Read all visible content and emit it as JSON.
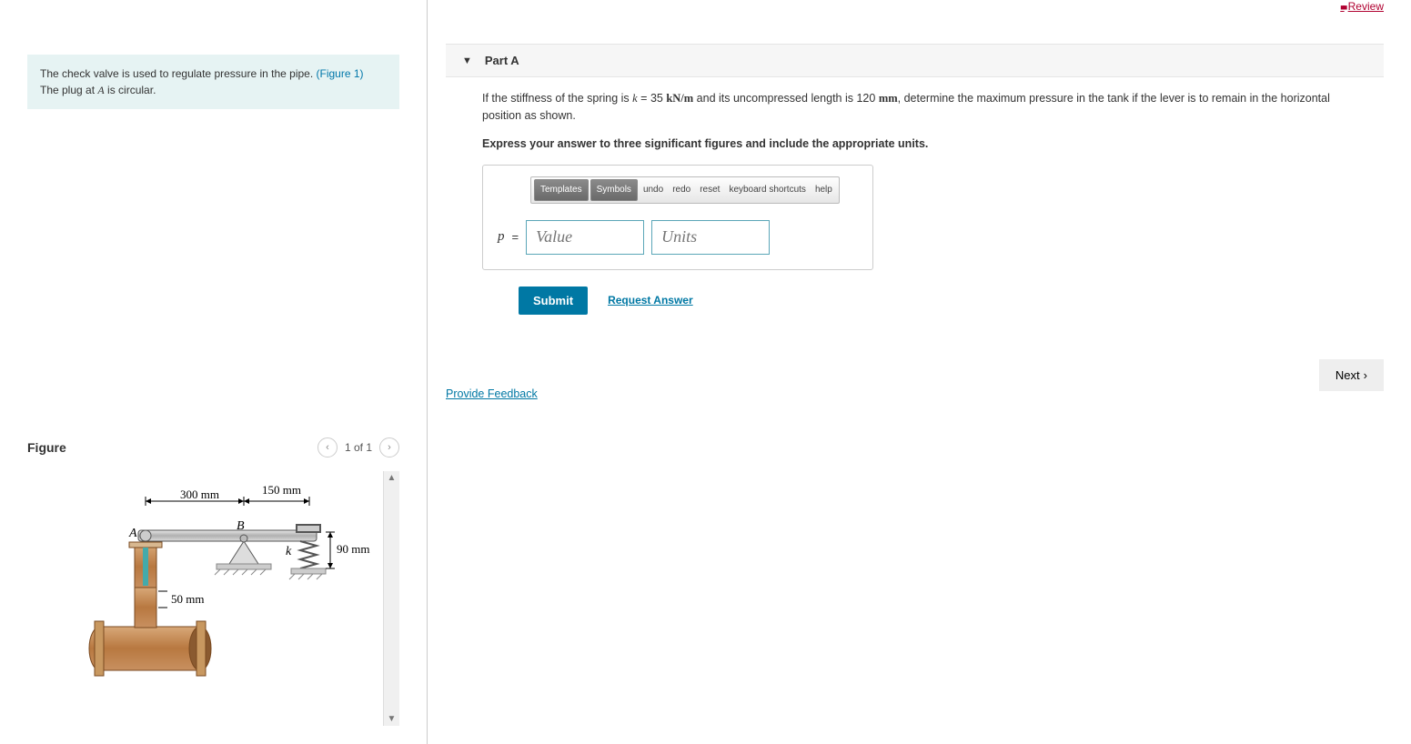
{
  "review_label": "Review",
  "problem": {
    "line1_a": "The check valve is used to regulate pressure in the pipe. ",
    "figure_link": "(Figure 1)",
    "line2_a": "The plug at ",
    "line2_var": "A",
    "line2_b": " is circular."
  },
  "figure": {
    "title": "Figure",
    "pager": "1 of 1",
    "dim_300": "300 mm",
    "dim_150": "150 mm",
    "dim_90": "90 mm",
    "dim_50": "50 mm",
    "label_A": "A",
    "label_B": "B",
    "label_k": "k"
  },
  "part": {
    "title": "Part A",
    "q1a": "If the stiffness of the spring is ",
    "q1_var": "k",
    "q1_eq": " = 35 ",
    "q1_unit": "kN/m",
    "q1b": " and its uncompressed length is 120 ",
    "q1_unit2": "mm",
    "q1c": ", determine the maximum pressure in the tank if the lever is to remain in the horizontal position as shown.",
    "instr": "Express your answer to three significant figures and include the appropriate units."
  },
  "toolbar": {
    "templates": "Templates",
    "symbols": "Symbols",
    "undo": "undo",
    "redo": "redo",
    "reset": "reset",
    "keyboard": "keyboard shortcuts",
    "help": "help"
  },
  "answer": {
    "var": "p",
    "eq": "=",
    "value_ph": "Value",
    "units_ph": "Units"
  },
  "buttons": {
    "submit": "Submit",
    "request": "Request Answer",
    "feedback": "Provide Feedback",
    "next": "Next"
  }
}
